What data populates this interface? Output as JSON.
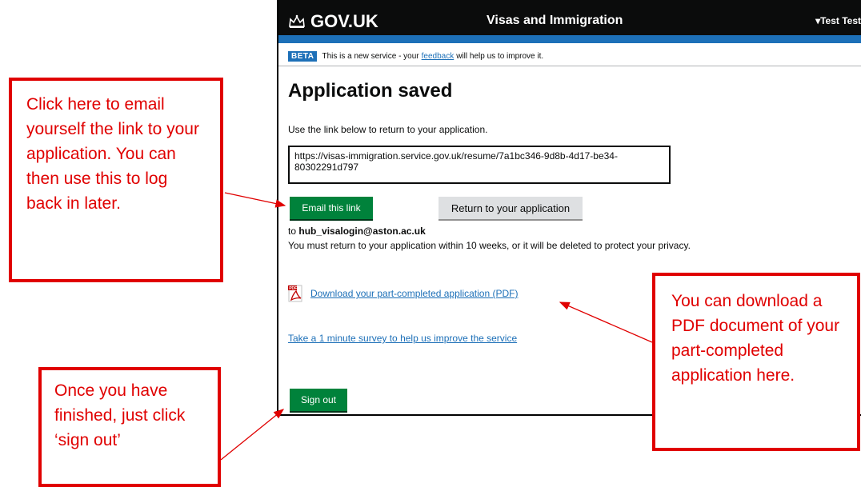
{
  "header": {
    "logo_text": "GOV.UK",
    "service_name": "Visas and Immigration",
    "user_menu": "▾Test Test"
  },
  "beta": {
    "tag": "BETA",
    "text_before": "This is a new service - your",
    "feedback_link": "feedback",
    "text_after": "will help us to improve it."
  },
  "main": {
    "title": "Application saved",
    "intro": "Use the link below to return to your application.",
    "resume_link": "https://visas-immigration.service.gov.uk/resume/7a1bc346-9d8b-4d17-be34-80302291d797",
    "email_button": "Email this link",
    "return_button": "Return to your application",
    "email_prefix": "to",
    "email_address": "hub_visalogin@aston.ac.uk",
    "warning": "You must return to your application within 10 weeks, or it will be deleted to protect your privacy.",
    "pdf_link": "Download your part-completed application (PDF)",
    "survey_link": "Take a 1 minute survey to help us improve the service",
    "signout_button": "Sign out"
  },
  "callouts": {
    "email": "Click here to email yourself the link to your application. You can then use this to log back in later.",
    "signout": "Once you have finished, just click ‘sign out’",
    "pdf": "You can download a PDF document of your part-completed application here."
  },
  "colors": {
    "header_bg": "#0b0c0c",
    "accent_blue": "#1d70b8",
    "button_green": "#00823b",
    "callout_red": "#e00000"
  },
  "icons": {
    "logo": "crown-icon",
    "pdf": "pdf-icon"
  }
}
